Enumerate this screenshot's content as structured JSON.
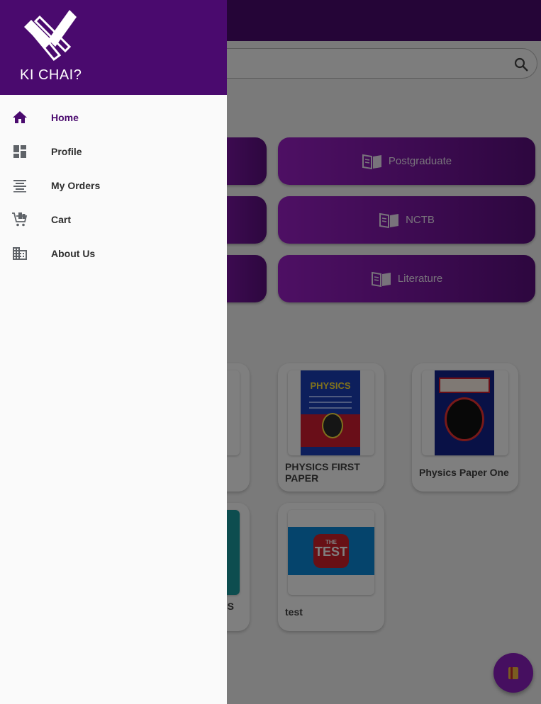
{
  "app": {
    "name": "KI CHAI?",
    "accent_color": "#4a0a6e",
    "button_gradient": [
      "#9c1fc8",
      "#5a0e7e"
    ]
  },
  "drawer": {
    "brand": "KI CHAI?",
    "items": [
      {
        "label": "Home",
        "icon": "home-icon",
        "active": true
      },
      {
        "label": "Profile",
        "icon": "dashboard-icon",
        "active": false
      },
      {
        "label": "My Orders",
        "icon": "list-icon",
        "active": false
      },
      {
        "label": "Cart",
        "icon": "cart-icon",
        "active": false
      },
      {
        "label": "About Us",
        "icon": "building-icon",
        "active": false
      }
    ]
  },
  "search": {
    "icon": "search-icon"
  },
  "categories": [
    {
      "label": "Postgraduate",
      "icon": "book-open-icon"
    },
    {
      "label": "NCTB",
      "icon": "book-open-icon"
    },
    {
      "label": "Literature",
      "icon": "book-open-icon"
    }
  ],
  "books": [
    {
      "title": "PHYSICS FIRST PAPER",
      "cover_text": "PHYSICS"
    },
    {
      "title": "Physics Paper One"
    },
    {
      "title": "ESS",
      "title_line2": ")"
    },
    {
      "title": "test",
      "cover_text_small": "THE",
      "cover_text": "TEST"
    }
  ],
  "fab": {
    "icon": "book-icon"
  }
}
